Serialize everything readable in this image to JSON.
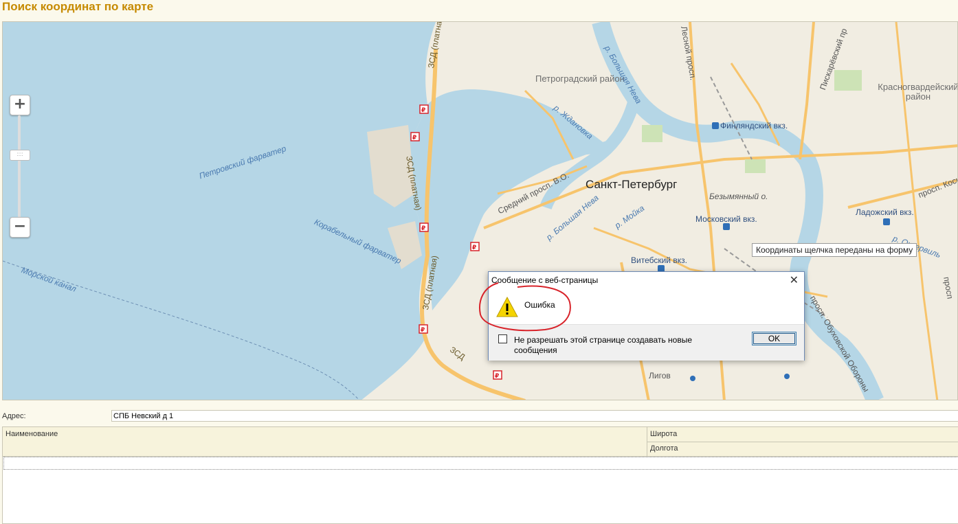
{
  "page": {
    "title": "Поиск координат по карте"
  },
  "map": {
    "labels": {
      "petrograd_district": "Петроградский район",
      "krasnogvard_district": "Красногвардейский район",
      "city": "Санкт-Петербург",
      "big_neva_north": "р. Большая Нева",
      "lesnoy": "Лесной просп.",
      "piskarevsky": "Пискарёвский пр",
      "zhdanovka": "р. Ждановка",
      "finlyandsky": "Финляндский вкз.",
      "petrovsky_farvater": "Петровский фарватер",
      "korabelny_farvater": "Корабельный фарватер",
      "morskoy_kanal": "Морской канал",
      "zsd_top": "ЗСД (платная)",
      "zsd_mid": "ЗСД (платная)",
      "zsd_low": "ЗСД (платная)",
      "zsd_short": "ЗСД",
      "sredny": "Средний просп. В.О.",
      "big_neva_south": "р. Большая Нева",
      "moyka": "р. Мойка",
      "bezymyanny": "Безымянный о.",
      "moskovsky": "Московский вкз.",
      "ladozhsky": "Ладожский вкз.",
      "kosygina": "просп. Косы",
      "okkervil": "р. Оккервиль",
      "vitebsky": "Витебский вкз.",
      "obukhovskoy": "просп. Обуховской Обороны",
      "ligovsky": "Лигов",
      "pros_right": "просп"
    },
    "zoom": {
      "plus_icon": "+",
      "minus_icon": "−",
      "thumb_icon": "::::"
    },
    "tooltip": "Координаты щелчка переданы на форму"
  },
  "dialog": {
    "title": "Сообщение с веб-страницы",
    "close_icon": "✕",
    "message": "Ошибка",
    "checkbox_label": "Не разрешать этой странице создавать новые сообщения",
    "ok_label": "OK"
  },
  "form": {
    "address_label": "Адрес:",
    "address_value": "СПБ Невский д 1"
  },
  "table": {
    "columns": {
      "name": "Наименование",
      "latitude": "Широта",
      "longitude": "Долгота"
    },
    "rows": []
  },
  "colors": {
    "title": "#c68a00",
    "water": "#b5d6e6",
    "land": "#f1ede2",
    "road": "#f7c46c",
    "accent_red": "#d8232a"
  }
}
